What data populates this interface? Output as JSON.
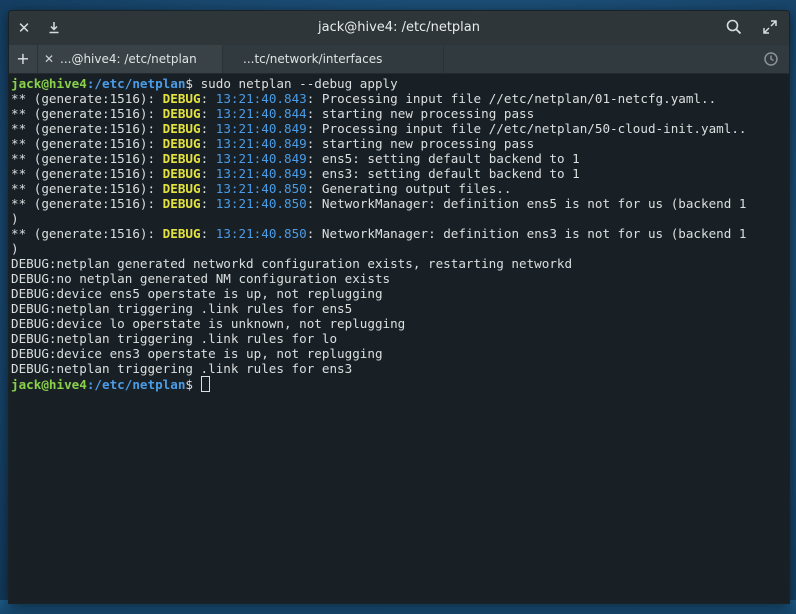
{
  "window": {
    "title": "jack@hive4: /etc/netplan"
  },
  "icons": {
    "close": "close-icon",
    "download": "download-icon",
    "search": "search-icon",
    "maximize": "maximize-icon",
    "new_tab": "plus-icon",
    "history": "history-icon"
  },
  "tabs": [
    {
      "label": "...@hive4: /etc/netplan"
    },
    {
      "label": "...tc/network/interfaces"
    }
  ],
  "colors": {
    "prompt_user": "#8ad14a",
    "prompt_path": "#4a9ce6",
    "debug_label": "#e3e23e",
    "timestamp": "#4a9ce6"
  },
  "prompt": {
    "user": "jack@hive4",
    "path": ":/etc/netplan",
    "symbol": "$ "
  },
  "command": "sudo netplan --debug apply",
  "log_lines": [
    {
      "prefix": "** (generate:1516): ",
      "level": "DEBUG",
      "sep": ": ",
      "time": "13:21:40.843",
      "msg": ": Processing input file //etc/netplan/01-netcfg.yaml.."
    },
    {
      "prefix": "** (generate:1516): ",
      "level": "DEBUG",
      "sep": ": ",
      "time": "13:21:40.844",
      "msg": ": starting new processing pass"
    },
    {
      "prefix": "** (generate:1516): ",
      "level": "DEBUG",
      "sep": ": ",
      "time": "13:21:40.849",
      "msg": ": Processing input file //etc/netplan/50-cloud-init.yaml.."
    },
    {
      "prefix": "** (generate:1516): ",
      "level": "DEBUG",
      "sep": ": ",
      "time": "13:21:40.849",
      "msg": ": starting new processing pass"
    },
    {
      "prefix": "** (generate:1516): ",
      "level": "DEBUG",
      "sep": ": ",
      "time": "13:21:40.849",
      "msg": ": ens5: setting default backend to 1"
    },
    {
      "prefix": "** (generate:1516): ",
      "level": "DEBUG",
      "sep": ": ",
      "time": "13:21:40.849",
      "msg": ": ens3: setting default backend to 1"
    },
    {
      "prefix": "** (generate:1516): ",
      "level": "DEBUG",
      "sep": ": ",
      "time": "13:21:40.850",
      "msg": ": Generating output files.."
    },
    {
      "prefix": "** (generate:1516): ",
      "level": "DEBUG",
      "sep": ": ",
      "time": "13:21:40.850",
      "msg": ": NetworkManager: definition ens5 is not for us (backend 1",
      "wrap": ")"
    },
    {
      "prefix": "** (generate:1516): ",
      "level": "DEBUG",
      "sep": ": ",
      "time": "13:21:40.850",
      "msg": ": NetworkManager: definition ens3 is not for us (backend 1",
      "wrap": ")"
    }
  ],
  "debug_lines": [
    "DEBUG:netplan generated networkd configuration exists, restarting networkd",
    "DEBUG:no netplan generated NM configuration exists",
    "DEBUG:device ens5 operstate is up, not replugging",
    "DEBUG:netplan triggering .link rules for ens5",
    "DEBUG:device lo operstate is unknown, not replugging",
    "DEBUG:netplan triggering .link rules for lo",
    "DEBUG:device ens3 operstate is up, not replugging",
    "DEBUG:netplan triggering .link rules for ens3"
  ]
}
